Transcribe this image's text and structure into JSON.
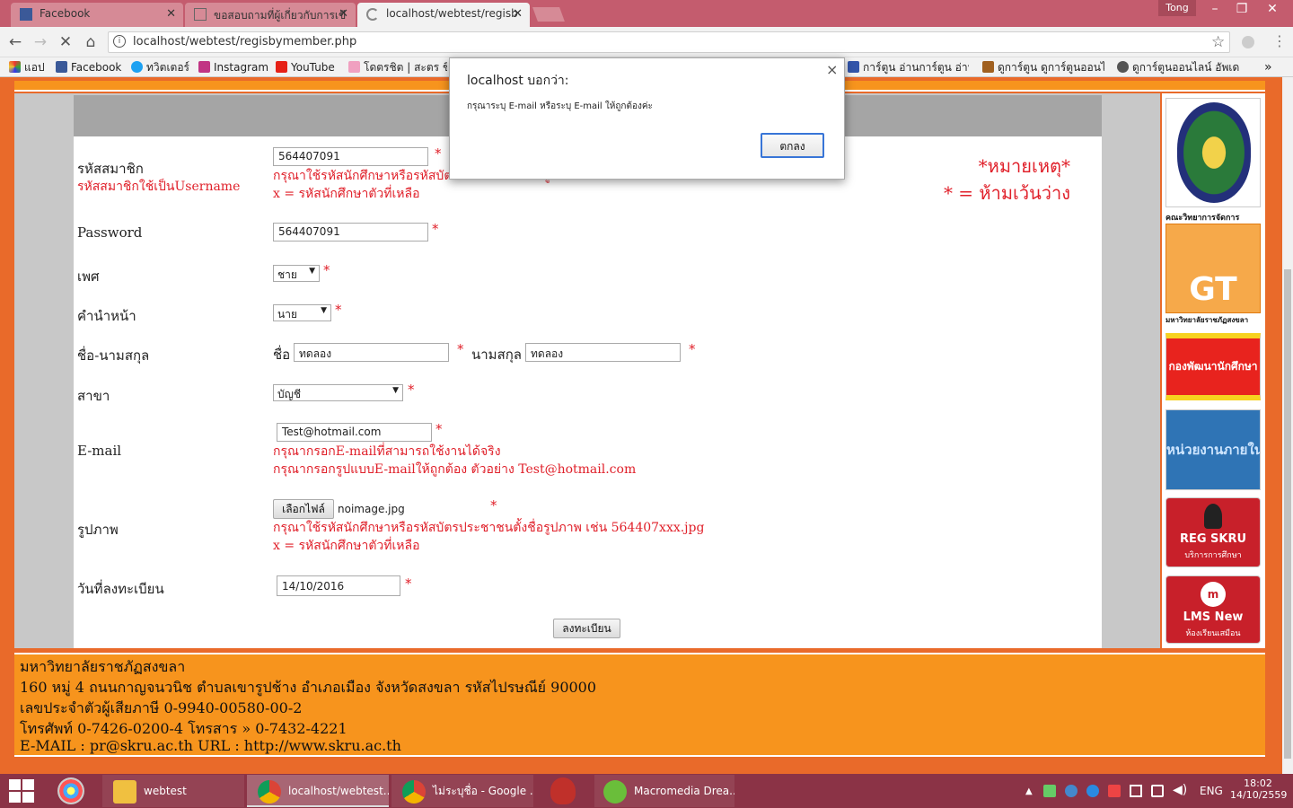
{
  "browser": {
    "tabs": [
      {
        "title": "Facebook"
      },
      {
        "title": "ขอสอบถามที่ผู้เกี่ยวกับการเขี"
      },
      {
        "title": "localhost/webtest/regisb"
      }
    ],
    "profile": "Tong",
    "url": "localhost/webtest/regisbymember.php",
    "bookmarks": [
      "แอป",
      "Facebook",
      "ทวิตเตอร์",
      "Instagram",
      "YouTube",
      "โดตรชิต | สะตร ชิรื่",
      "การ์ตูน อ่านการ์ตูน อ่านก",
      "ดูการ์ตูน ดูการ์ตูนออนไลน์",
      "ดูการ์ตูนออนไลน์ อัพเดทิ"
    ],
    "bookmarks_more": "»"
  },
  "dialog": {
    "title": "localhost บอกว่า:",
    "message": "กรุณาระบุ E-mail หรือระบุ E-mail ให้ถูกต้องค่ะ",
    "ok_label": "ตกลง",
    "close": "×"
  },
  "form": {
    "member_id": {
      "label": "รหัสสมาชิก",
      "sublabel": "รหัสสมาชิกใช้เป็นUsername",
      "value": "564407091",
      "hint1": "กรุณาใช้รหัสนักศึกษาหรือรหัสบัตรประชาชนตั้งชื่อรูปภาพ เช่น 564407xxx",
      "hint2": "x = รหัสนักศึกษาตัวที่เหลือ"
    },
    "password": {
      "label": "Password",
      "value": "564407091"
    },
    "gender": {
      "label": "เพศ",
      "value": "ชาย"
    },
    "prefix": {
      "label": "คำนำหน้า",
      "value": "นาย"
    },
    "name": {
      "label": "ชื่อ-นามสกุล",
      "first_label": "ชื่อ",
      "first_value": "ทดลอง",
      "last_label": "นามสกุล",
      "last_value": "ทดลอง"
    },
    "major": {
      "label": "สาขา",
      "value": "บัญชี"
    },
    "email": {
      "label": "E-mail",
      "value": "Test@hotmail.com",
      "hint1": "กรุณากรอกE-mailที่สามารถใช้งานได้จริง",
      "hint2": "กรุณากรอกรูปแบบE-mailให้ถูกต้อง ตัวอย่าง Test@hotmail.com"
    },
    "photo": {
      "label": "รูปภาพ",
      "button": "เลือกไฟล์",
      "filename": "noimage.jpg",
      "hint1": "กรุณาใช้รหัสนักศึกษาหรือรหัสบัตรประชาชนตั้งชื่อรูปภาพ เช่น 564407xxx.jpg",
      "hint2": "x = รหัสนักศึกษาตัวที่เหลือ"
    },
    "regdate": {
      "label": "วันที่ลงทะเบียน",
      "value": "14/10/2016"
    },
    "required": "*",
    "submit": "ลงทะเบียน"
  },
  "note": {
    "line1": "*หมายเหตุ*",
    "line2": "* = ห้ามเว้นว่าง"
  },
  "sidebar": {
    "faculty": "คณะวิทยาการจัดการ",
    "gt_caption": "มหาวิทยาลัยราชภัฏสงขลา",
    "gt_text": "GT",
    "dev": "กองพัฒนานักศึกษา",
    "internal": "หน่วยงานภายใน",
    "reg": "REG SKRU",
    "reg_sub": "บริการการศึกษา",
    "lms": "LMS New",
    "lms_sub": "ห้องเรียนเสมือน"
  },
  "footer": {
    "line1": "มหาวิทยาลัยราชภัฏสงขลา",
    "line2": "160 หมู่ 4 ถนนกาญจนวนิช ตำบลเขารูปช้าง อำเภอเมือง จังหวัดสงขลา รหัสไปรษณีย์ 90000",
    "line3": "เลขประจำตัวผู้เสียภาษี 0-9940-00580-00-2",
    "line4": "โทรศัพท์ 0-7426-0200-4 โทรสาร » 0-7432-4221",
    "line5": "E-MAIL : pr@skru.ac.th URL : http://www.skru.ac.th"
  },
  "taskbar": {
    "items": [
      "webtest",
      "localhost/webtest...",
      "ไม่ระบุชื่อ - Google ...",
      "Macromedia Drea..."
    ],
    "lang": "ENG",
    "time": "18:02",
    "date": "14/10/2559"
  }
}
